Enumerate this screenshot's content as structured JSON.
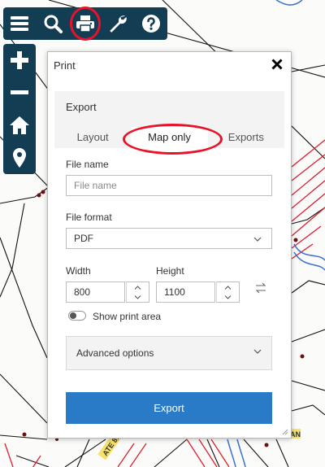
{
  "map": {
    "road_label": "ATE 81-8",
    "tag_label": "AN",
    "colors": {
      "parcel_red": "#e01e2f",
      "water_blue": "#3a6fd6",
      "background": "#fbfbf9"
    }
  },
  "toolbar": {
    "icons": [
      "menu-icon",
      "search-icon",
      "print-icon",
      "wrench-icon",
      "help-icon"
    ],
    "highlighted": "print-icon",
    "color": "#123d52"
  },
  "map_controls": {
    "icons": [
      "zoom-in-icon",
      "zoom-out-icon",
      "home-icon",
      "location-pin-icon"
    ]
  },
  "print_panel": {
    "title": "Print",
    "close_icon": "close-icon",
    "section_title": "Export",
    "tabs": [
      {
        "label": "Layout",
        "active": false
      },
      {
        "label": "Map only",
        "active": true
      },
      {
        "label": "Exports",
        "active": false
      }
    ],
    "file_name": {
      "label": "File name",
      "value": "",
      "placeholder": "File name"
    },
    "file_format": {
      "label": "File format",
      "value": "PDF"
    },
    "width": {
      "label": "Width",
      "value": "800"
    },
    "height": {
      "label": "Height",
      "value": "1100"
    },
    "show_print_area": {
      "label": "Show print area",
      "on": false
    },
    "advanced": {
      "label": "Advanced options"
    },
    "export_button": "Export",
    "accent": "#2a7bc7",
    "highlight_ring": "#e8122a"
  }
}
